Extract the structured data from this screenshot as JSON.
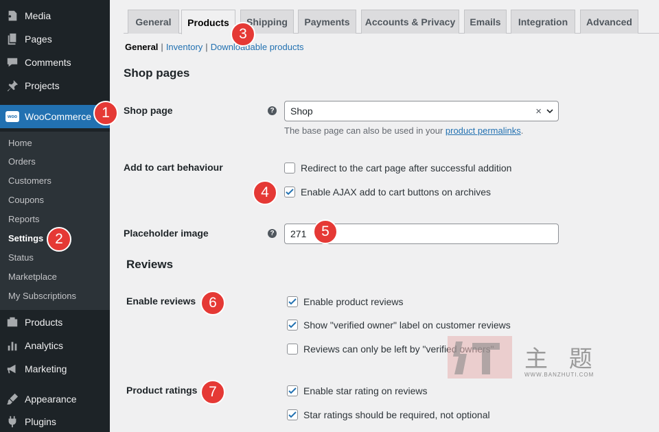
{
  "sidebar": {
    "top_items": [
      {
        "label": "Media",
        "icon": "media-icon"
      },
      {
        "label": "Pages",
        "icon": "pages-icon"
      },
      {
        "label": "Comments",
        "icon": "comments-icon"
      },
      {
        "label": "Projects",
        "icon": "pin-icon"
      }
    ],
    "woocommerce_label": "WooCommerce",
    "woo_badge": "woo",
    "submenu": [
      "Home",
      "Orders",
      "Customers",
      "Coupons",
      "Reports",
      "Settings",
      "Status",
      "Marketplace",
      "My Subscriptions"
    ],
    "current_submenu": "Settings",
    "bottom_items": [
      {
        "label": "Products",
        "icon": "products-icon"
      },
      {
        "label": "Analytics",
        "icon": "analytics-icon"
      },
      {
        "label": "Marketing",
        "icon": "megaphone-icon"
      },
      {
        "label": "Appearance",
        "icon": "brush-icon"
      },
      {
        "label": "Plugins",
        "icon": "plugin-icon"
      }
    ]
  },
  "tabs": [
    "General",
    "Products",
    "Shipping",
    "Payments",
    "Accounts & Privacy",
    "Emails",
    "Integration",
    "Advanced"
  ],
  "active_tab": "Products",
  "sublinks": {
    "current": "General",
    "sep": "|",
    "inventory": "Inventory",
    "downloadable": "Downloadable products"
  },
  "shop_pages": {
    "heading": "Shop pages",
    "shop_page_label": "Shop page",
    "shop_page_value": "Shop",
    "clear_symbol": "×",
    "desc_before": "The base page can also be used in your ",
    "desc_link": "product permalinks",
    "desc_after": ".",
    "cart_label": "Add to cart behaviour",
    "cart_opt1": "Redirect to the cart page after successful addition",
    "cart_opt2": "Enable AJAX add to cart buttons on archives",
    "placeholder_label": "Placeholder image",
    "placeholder_value": "271",
    "help_symbol": "?"
  },
  "reviews": {
    "heading": "Reviews",
    "enable_label": "Enable reviews",
    "opt1": "Enable product reviews",
    "opt2": "Show \"verified owner\" label on customer reviews",
    "opt3": "Reviews can only be left by \"verified owners\"",
    "ratings_label": "Product ratings",
    "rating_opt1": "Enable star rating on reviews",
    "rating_opt2": "Star ratings should be required, not optional"
  },
  "badges": [
    "1",
    "2",
    "3",
    "4",
    "5",
    "6",
    "7"
  ],
  "watermark": {
    "chars": "主 题",
    "url": "WWW.BANZHUTI.COM"
  },
  "colors": {
    "accent": "#2271b1",
    "badge": "#e53935",
    "sidebar": "#1d2327"
  }
}
